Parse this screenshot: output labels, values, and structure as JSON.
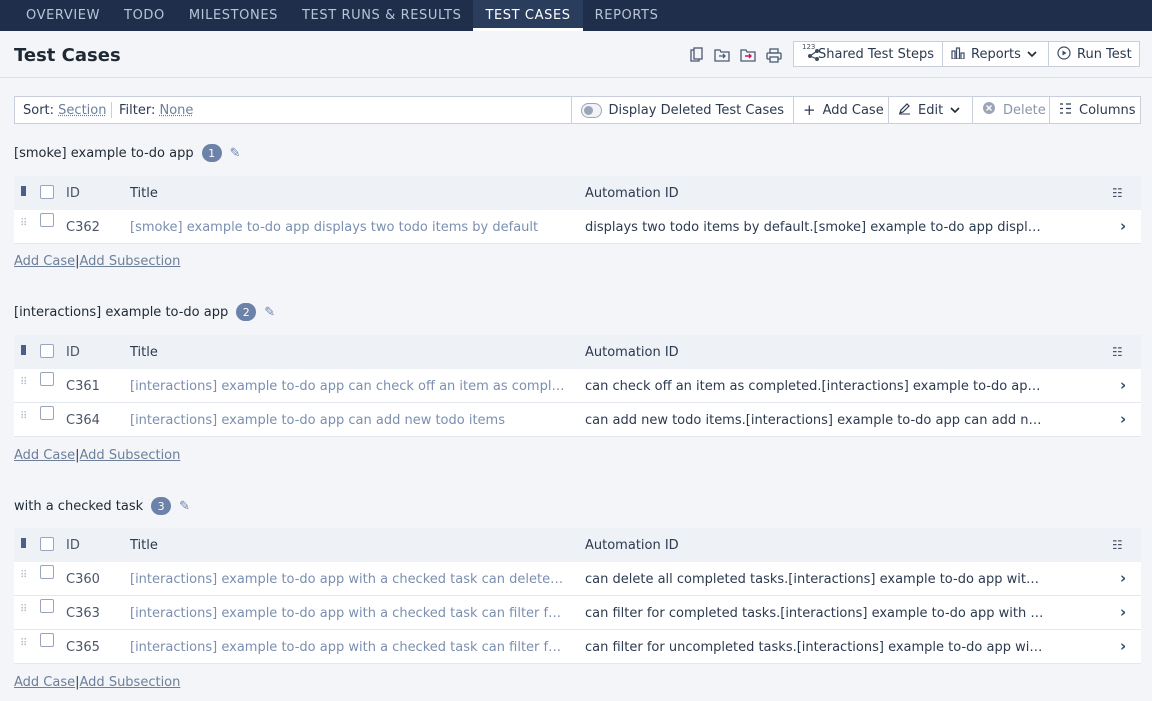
{
  "nav": {
    "tabs": [
      {
        "label": "OVERVIEW"
      },
      {
        "label": "TODO"
      },
      {
        "label": "MILESTONES"
      },
      {
        "label": "TEST RUNS & RESULTS"
      },
      {
        "label": "TEST CASES",
        "active": true
      },
      {
        "label": "REPORTS"
      }
    ]
  },
  "header": {
    "title": "Test Cases",
    "icons": [
      "copy-icon",
      "move-icon",
      "export-icon",
      "print-icon"
    ],
    "shared_steps_label": "Shared Test Steps",
    "shared_steps_badge": "123",
    "reports_label": "Reports",
    "run_test_label": "Run Test"
  },
  "toolbar": {
    "sort_label": "Sort:",
    "sort_value": "Section",
    "filter_label": "Filter:",
    "filter_value": "None",
    "display_deleted_label": "Display Deleted Test Cases",
    "add_case_label": "Add Case",
    "edit_label": "Edit",
    "delete_label": "Delete",
    "columns_label": "Columns"
  },
  "table_headers": {
    "id": "ID",
    "title": "Title",
    "automation_id": "Automation ID"
  },
  "add_links": {
    "add_case": "Add Case",
    "separator": "|",
    "add_subsection": "Add Subsection"
  },
  "sections": [
    {
      "name": "[smoke] example to-do app",
      "count": "1",
      "rows": [
        {
          "id": "C362",
          "title": "[smoke] example to-do app displays two todo items by default",
          "automation_id": "displays two todo items by default.[smoke] example to-do app displays tw..."
        }
      ]
    },
    {
      "name": "[interactions] example to-do app",
      "count": "2",
      "rows": [
        {
          "id": "C361",
          "title": "[interactions] example to-do app can check off an item as completed",
          "automation_id": "can check off an item as completed.[interactions] example to-do app can ..."
        },
        {
          "id": "C364",
          "title": "[interactions] example to-do app can add new todo items",
          "automation_id": "can add new todo items.[interactions] example to-do app can add new tod..."
        }
      ]
    },
    {
      "name": "with a checked task",
      "count": "3",
      "rows": [
        {
          "id": "C360",
          "title": "[interactions] example to-do app with a checked task can delete all co...",
          "automation_id": "can delete all completed tasks.[interactions] example to-do app with a che..."
        },
        {
          "id": "C363",
          "title": "[interactions] example to-do app with a checked task can filter for co...",
          "automation_id": "can filter for completed tasks.[interactions] example to-do app with a che..."
        },
        {
          "id": "C365",
          "title": "[interactions] example to-do app with a checked task can filter for unc...",
          "automation_id": "can filter for uncompleted tasks.[interactions] example to-do app with a c..."
        }
      ]
    }
  ]
}
